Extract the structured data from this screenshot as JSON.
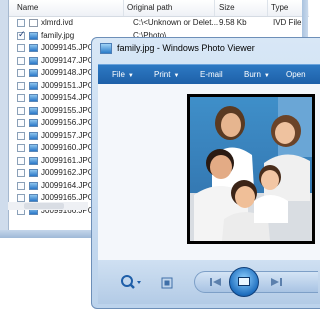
{
  "file_list": {
    "columns": [
      "Name",
      "Original path",
      "Size",
      "Type"
    ],
    "rows": [
      {
        "name": "xlmrd.ivd",
        "path": "C:\\<Unknown or Delet...",
        "size": "9.58 Kb",
        "type": "IVD File",
        "checked": false,
        "icon": "text-file-icon"
      },
      {
        "name": "family.jpg",
        "path": "C:\\Photo\\",
        "size": "",
        "type": "",
        "checked": true,
        "icon": "image-file-icon"
      },
      {
        "name": "J0099145.JPG",
        "checked": false,
        "icon": "image-file-icon"
      },
      {
        "name": "J0099147.JPG",
        "checked": false,
        "icon": "image-file-icon"
      },
      {
        "name": "J0099148.JPG",
        "checked": false,
        "icon": "image-file-icon"
      },
      {
        "name": "J0099151.JPG",
        "checked": false,
        "icon": "image-file-icon"
      },
      {
        "name": "J0099154.JPG",
        "checked": false,
        "icon": "image-file-icon"
      },
      {
        "name": "J0099155.JPG",
        "checked": false,
        "icon": "image-file-icon"
      },
      {
        "name": "J0099156.JPG",
        "checked": false,
        "icon": "image-file-icon"
      },
      {
        "name": "J0099157.JPG",
        "checked": false,
        "icon": "image-file-icon"
      },
      {
        "name": "J0099160.JPG",
        "checked": false,
        "icon": "image-file-icon"
      },
      {
        "name": "J0099161.JPG",
        "checked": false,
        "icon": "image-file-icon"
      },
      {
        "name": "J0099162.JPG",
        "checked": false,
        "icon": "image-file-icon"
      },
      {
        "name": "J0099164.JPG",
        "checked": false,
        "icon": "image-file-icon"
      },
      {
        "name": "J0099165.JPG",
        "checked": false,
        "icon": "image-file-icon"
      },
      {
        "name": "J0099166.JPG",
        "checked": false,
        "icon": "image-file-icon"
      }
    ]
  },
  "photo_viewer": {
    "title": "family.jpg - Windows Photo Viewer",
    "menu": [
      {
        "label": "File",
        "dropdown": true
      },
      {
        "label": "Print",
        "dropdown": true
      },
      {
        "label": "E-mail",
        "dropdown": false
      },
      {
        "label": "Burn",
        "dropdown": true
      },
      {
        "label": "Open",
        "dropdown": false
      }
    ],
    "toolbar_icons": [
      "zoom-icon",
      "fit-window-icon",
      "previous-icon",
      "slideshow-icon",
      "next-icon"
    ]
  },
  "colors": {
    "menu_bar": "#1d5fa7",
    "window_frame": "#bcd3ec",
    "content_bg": "#f4f7fb",
    "accent": "#2b7cc8"
  }
}
